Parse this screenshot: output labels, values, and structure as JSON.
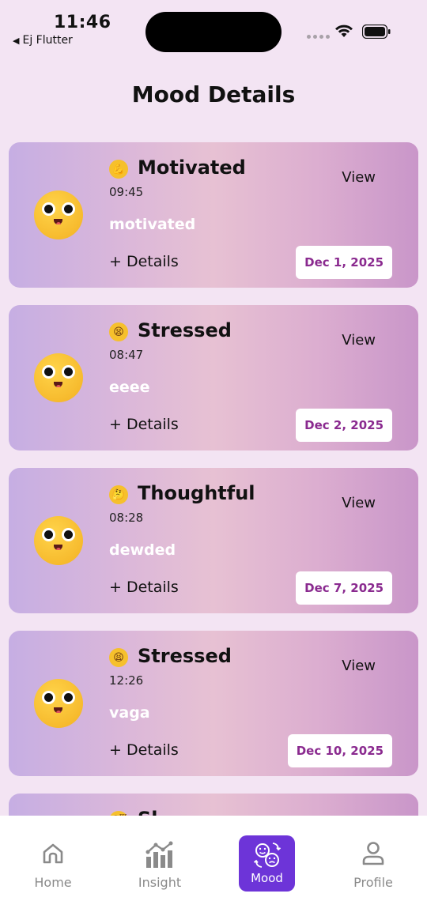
{
  "status": {
    "time": "11:46",
    "back_label": "Ej Flutter"
  },
  "page": {
    "title": "Mood Details"
  },
  "entries": [
    {
      "emoji": "💪",
      "mood": "Motivated",
      "time": "09:45",
      "note": "motivated",
      "details": "+ Details",
      "view": "View",
      "date": "Dec 1, 2025"
    },
    {
      "emoji": "😫",
      "mood": "Stressed",
      "time": "08:47",
      "note": "eeee",
      "details": "+ Details",
      "view": "View",
      "date": "Dec 2, 2025"
    },
    {
      "emoji": "🤔",
      "mood": "Thoughtful",
      "time": "08:28",
      "note": "dewded",
      "details": "+ Details",
      "view": "View",
      "date": "Dec 7, 2025"
    },
    {
      "emoji": "😫",
      "mood": "Stressed",
      "time": "12:26",
      "note": "vaga",
      "details": "+ Details",
      "view": "View",
      "date": "Dec 10, 2025"
    },
    {
      "emoji": "😴",
      "mood": "Sl",
      "time": "",
      "note": "",
      "details": "",
      "view": "",
      "date": ""
    }
  ],
  "nav": {
    "home": "Home",
    "insight": "Insight",
    "mood": "Mood",
    "profile": "Profile",
    "active": "mood",
    "active_color": "#6d34d8"
  }
}
